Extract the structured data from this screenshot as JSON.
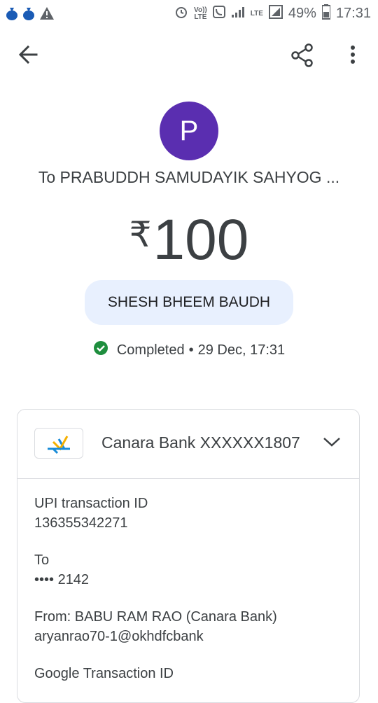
{
  "statusbar": {
    "battery_pct": "49%",
    "time": "17:31",
    "network": "LTE",
    "volte_top": "Vo))",
    "volte_bottom": "LTE"
  },
  "header": {
    "avatar_letter": "P",
    "recipient": "To PRABUDDH SAMUDAYIK SAHYOG ...",
    "currency_symbol": "₹",
    "amount": "100",
    "note": "SHESH BHEEM BAUDH",
    "status": "Completed",
    "separator": "•",
    "datetime": "29 Dec, 17:31"
  },
  "card": {
    "bank_name": "Canara Bank XXXXXX1807",
    "details": [
      {
        "label": "UPI transaction ID",
        "value": "136355342271"
      },
      {
        "label": "To",
        "value": "•••• 2142"
      },
      {
        "label": "From: BABU  RAM RAO (Canara Bank)",
        "value": "aryanrao70-1@okhdfcbank"
      },
      {
        "label": "Google Transaction ID",
        "value": ""
      }
    ]
  },
  "colors": {
    "avatar": "#5a2eb0",
    "chip_bg": "#e8f0fe",
    "success": "#1e8e3e"
  }
}
